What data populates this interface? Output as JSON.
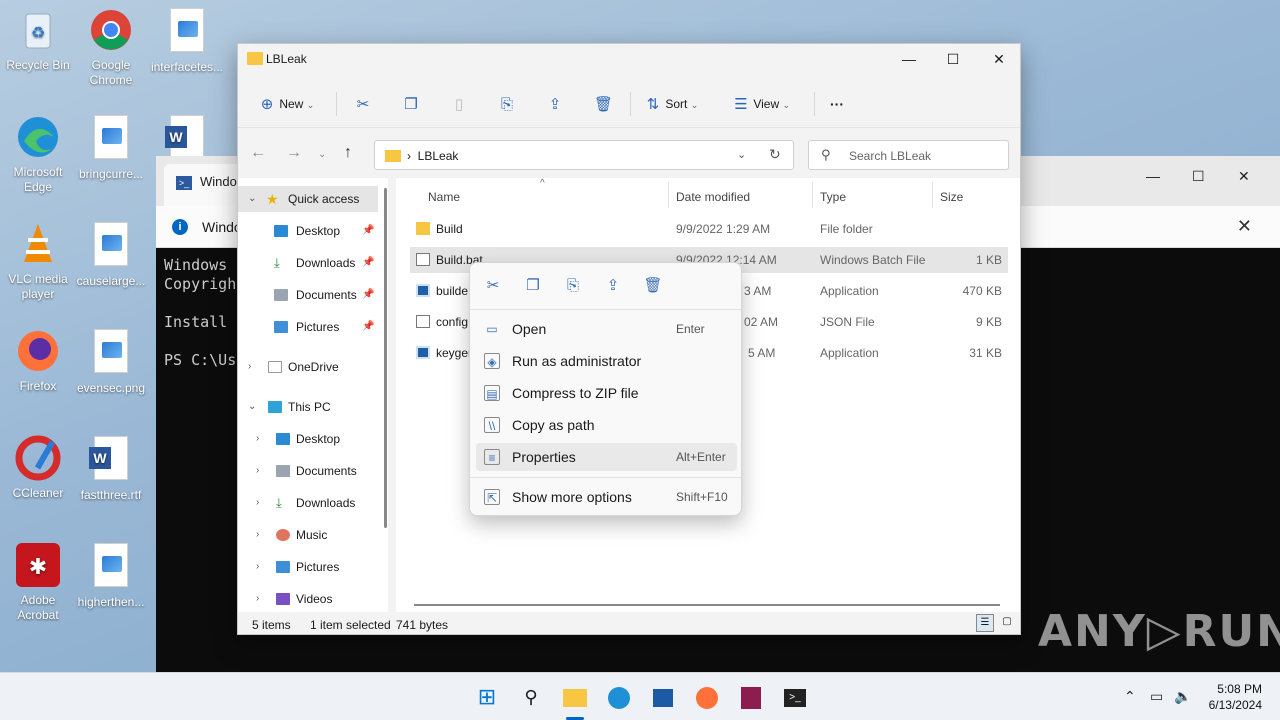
{
  "desktop": {
    "icons": [
      {
        "label": "Recycle Bin"
      },
      {
        "label": "Google Chrome"
      },
      {
        "label": "interfacetes..."
      },
      {
        "label": "Microsoft Edge"
      },
      {
        "label": "bringcurre..."
      },
      {
        "label": ""
      },
      {
        "label": "VLC media player"
      },
      {
        "label": "causelarge..."
      },
      {
        "label": "Firefox"
      },
      {
        "label": "evensec.png"
      },
      {
        "label": "CCleaner"
      },
      {
        "label": "fastthree.rtf"
      },
      {
        "label": "Adobe Acrobat"
      },
      {
        "label": "higherthen..."
      }
    ]
  },
  "terminal": {
    "tab_title": "Windo",
    "info_text": "Windo",
    "lines": "Windows\nCopyrigh\n\nInstall\n\nPS C:\\Us"
  },
  "explorer": {
    "title": "LBLeak",
    "toolbar": {
      "new": "New",
      "sort": "Sort",
      "view": "View",
      "more": "···"
    },
    "address": {
      "crumb": "LBLeak"
    },
    "search_placeholder": "Search LBLeak",
    "nav": {
      "quick_access": "Quick access",
      "qa_items": [
        "Desktop",
        "Downloads",
        "Documents",
        "Pictures"
      ],
      "onedrive": "OneDrive",
      "this_pc": "This PC",
      "pc_items": [
        "Desktop",
        "Documents",
        "Downloads",
        "Music",
        "Pictures",
        "Videos"
      ]
    },
    "columns": {
      "name": "Name",
      "date": "Date modified",
      "type": "Type",
      "size": "Size"
    },
    "files": [
      {
        "name": "Build",
        "date": "9/9/2022 1:29 AM",
        "type": "File folder",
        "size": ""
      },
      {
        "name": "Build.bat",
        "date": "9/9/2022 12:14 AM",
        "type": "Windows Batch File",
        "size": "1 KB"
      },
      {
        "name": "builde",
        "date": "3 AM",
        "type": "Application",
        "size": "470 KB"
      },
      {
        "name": "config",
        "date": "02 AM",
        "type": "JSON File",
        "size": "9 KB"
      },
      {
        "name": "keygen",
        "date": "5 AM",
        "type": "Application",
        "size": "31 KB"
      }
    ],
    "status": {
      "count": "5 items",
      "selected": "1 item selected",
      "bytes": "741 bytes"
    }
  },
  "context_menu": {
    "items": [
      {
        "label": "Open",
        "shortcut": "Enter"
      },
      {
        "label": "Run as administrator",
        "shortcut": ""
      },
      {
        "label": "Compress to ZIP file",
        "shortcut": ""
      },
      {
        "label": "Copy as path",
        "shortcut": ""
      },
      {
        "label": "Properties",
        "shortcut": "Alt+Enter"
      },
      {
        "label": "Show more options",
        "shortcut": "Shift+F10"
      }
    ]
  },
  "taskbar": {
    "time": "5:08 PM",
    "date": "6/13/2024"
  },
  "watermark": "ANY▷RUN",
  "colors": {
    "accent": "#0067c0",
    "folder": "#f7c744"
  }
}
